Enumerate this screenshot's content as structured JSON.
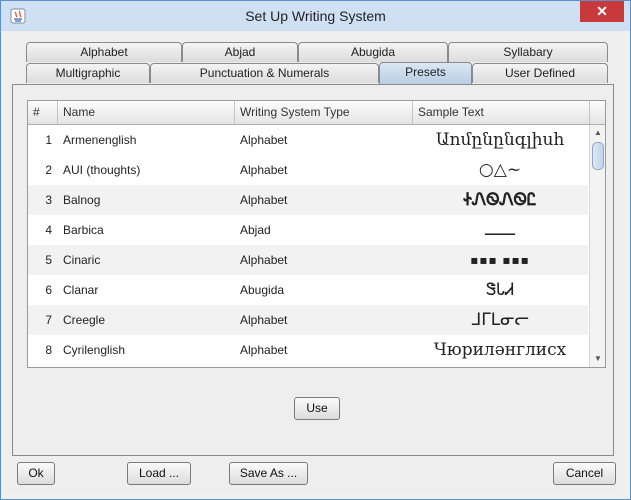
{
  "window": {
    "title": "Set Up Writing System",
    "close_label": "✕"
  },
  "tabs_row1": [
    "Alphabet",
    "Abjad",
    "Abugida",
    "Syllabary"
  ],
  "tabs_row2": [
    "Multigraphic",
    "Punctuation & Numerals",
    "Presets",
    "User Defined"
  ],
  "selected_tab": "Presets",
  "table": {
    "headers": [
      "#",
      "Name",
      "Writing System Type",
      "Sample Text"
    ],
    "rows": [
      {
        "num": "1",
        "name": "Armenenglish",
        "type": "Alphabet",
        "sample": "Աոմընընգլիսհ"
      },
      {
        "num": "2",
        "name": "AUI (thoughts)",
        "type": "Alphabet",
        "sample": "○△~"
      },
      {
        "num": "3",
        "name": "Balnog",
        "type": "Alphabet",
        "sample": "ᏐᏁᏫᏁᏫᏝ"
      },
      {
        "num": "4",
        "name": "Barbica",
        "type": "Abjad",
        "sample": "ــــــ"
      },
      {
        "num": "5",
        "name": "Cinaric",
        "type": "Alphabet",
        "sample": "▪▪▪ ▪▪▪"
      },
      {
        "num": "6",
        "name": "Clanar",
        "type": "Abugida",
        "sample": "ᏕᏓᏗ"
      },
      {
        "num": "7",
        "name": "Creegle",
        "type": "Alphabet",
        "sample": "ᒧᒥᒪᓂᓕ"
      },
      {
        "num": "8",
        "name": "Cyrilenglish",
        "type": "Alphabet",
        "sample": "Чюриләнглисх"
      }
    ]
  },
  "buttons": {
    "use": "Use",
    "ok": "Ok",
    "load": "Load ...",
    "save_as": "Save As ...",
    "cancel": "Cancel"
  }
}
